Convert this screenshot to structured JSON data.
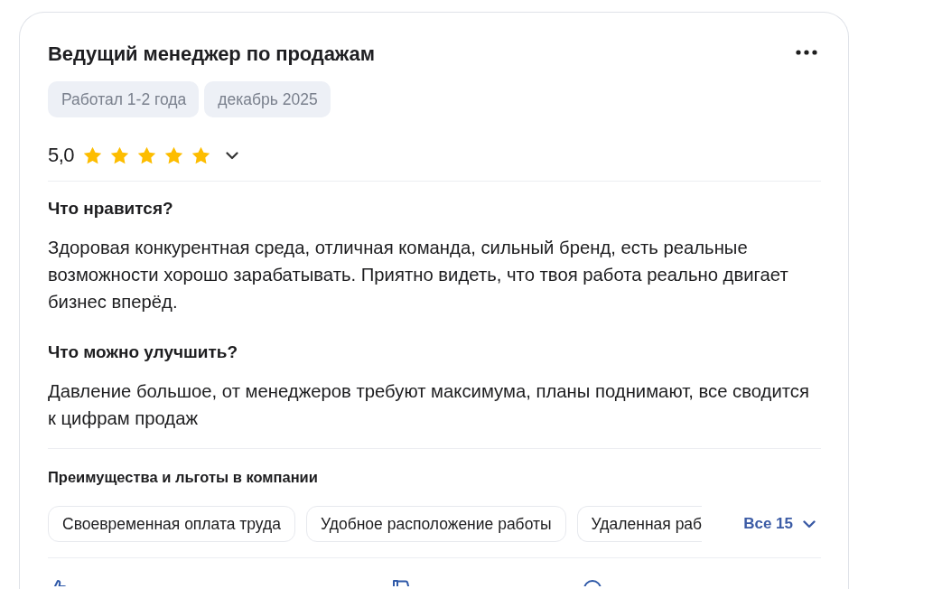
{
  "review": {
    "title": "Ведущий менеджер по продажам",
    "tags": [
      "Работал 1-2 года",
      "декабрь 2025"
    ],
    "rating": {
      "score": "5,0",
      "stars": 5
    },
    "sections": [
      {
        "heading": "Что нравится?",
        "text": "Здоровая конкурентная среда, отличная команда, сильный бренд, есть реальные возможности хорошо зарабатывать. Приятно видеть, что твоя работа реально двигает бизнес вперёд."
      },
      {
        "heading": "Что можно улучшить?",
        "text": "Давление большое, от менеджеров требуют максимума, планы поднимают, все сводится к цифрам продаж"
      }
    ],
    "benefits": {
      "heading": "Преимущества и льготы в компании",
      "items": [
        "Своевременная оплата труда",
        "Удобное расположение работы",
        "Удаленная раб"
      ],
      "more_link": "Все 15"
    }
  }
}
